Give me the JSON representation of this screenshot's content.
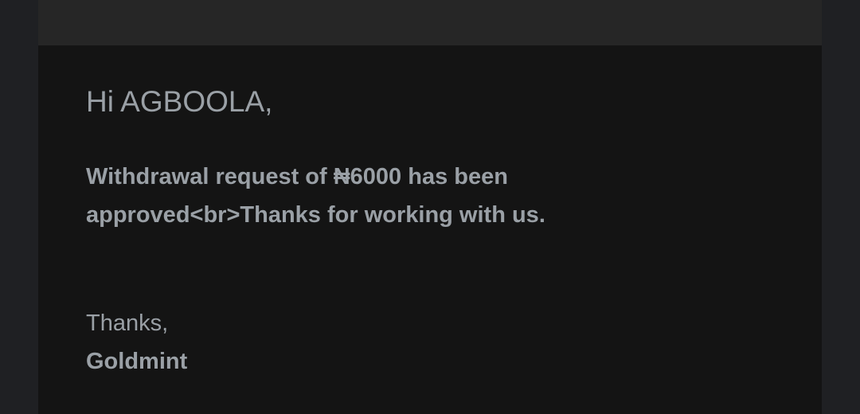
{
  "email": {
    "greeting": "Hi AGBOOLA,",
    "message": "Withdrawal request of ₦6000 has been approved<br>Thanks for working with us.",
    "closing": "Thanks,",
    "signature": "Goldmint"
  },
  "colors": {
    "page_background": "#1f2023",
    "header_band": "#262626",
    "card_background": "#141414",
    "text": "#9aa0a6"
  }
}
